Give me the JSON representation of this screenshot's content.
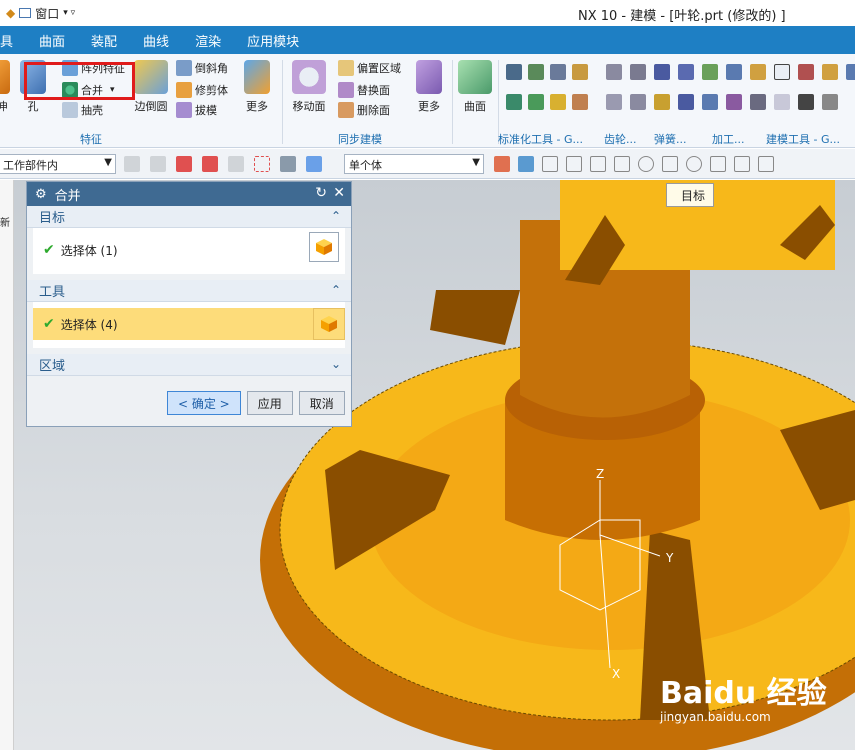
{
  "titlebar": {
    "window_menu": "窗口",
    "title": "NX 10 - 建模 - [叶轮.prt  (修改的) ]"
  },
  "menubar": {
    "items": [
      "具",
      "曲面",
      "装配",
      "曲线",
      "渲染",
      "应用模块"
    ]
  },
  "ribbon": {
    "feature_group": {
      "label": "特征",
      "items": {
        "pull": "伸",
        "hole": "孔",
        "array": "阵列特征",
        "combine": "合并",
        "shell": "抽壳",
        "edge_blend": "边倒圆",
        "chamfer": "倒斜角",
        "trim_body": "修剪体",
        "draft": "拔模",
        "more": "更多"
      }
    },
    "sync_group": {
      "label": "同步建模",
      "items": {
        "move_face": "移动面",
        "offset_region": "偏置区域",
        "replace_face": "替换面",
        "delete_face": "删除面",
        "more": "更多"
      }
    },
    "surface": {
      "label": "曲面"
    },
    "other_groups": [
      "标准化工具 - G...",
      "齿轮...",
      "弹簧...",
      "加工...",
      "建模工具 - G..."
    ]
  },
  "toolbar2": {
    "filter_select": "工作部件内",
    "body_select": "单个体"
  },
  "dialog": {
    "title": "合并",
    "target_section": "目标",
    "target_row": "选择体 (1)",
    "tool_section": "工具",
    "tool_row": "选择体 (4)",
    "region_section": "区域",
    "ok": "< 确定 >",
    "apply": "应用",
    "cancel": "取消"
  },
  "left_panel": {
    "label": "新"
  },
  "tooltip": {
    "text": "目标"
  },
  "axes": {
    "x": "X",
    "y": "Y",
    "z": "Z"
  },
  "watermark": {
    "logo": "Baidu 经验",
    "url": "jingyan.baidu.com"
  },
  "colors": {
    "menubar": "#1e7fc4",
    "highlight": "#e01b1b",
    "selected_row": "#fddc7a",
    "model_yellow": "#f7b81a"
  }
}
